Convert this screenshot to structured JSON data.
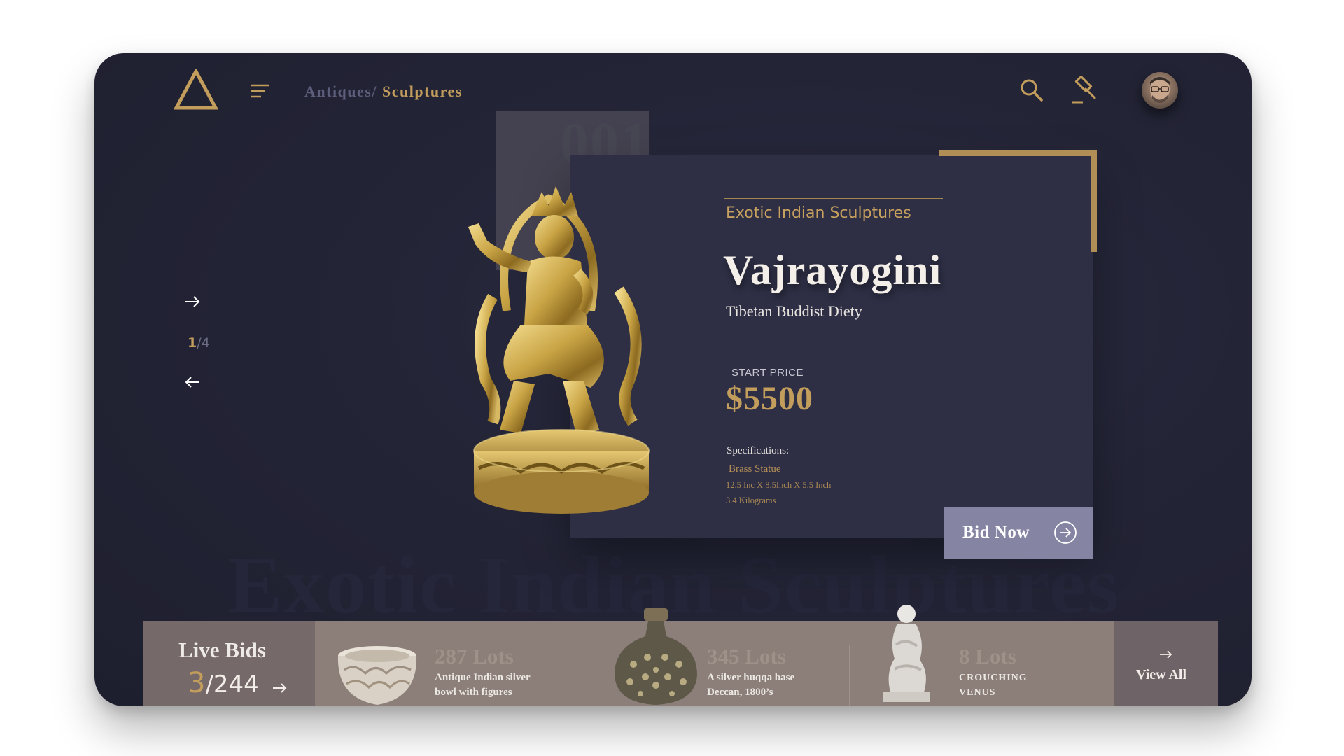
{
  "header": {
    "logo": "triangle-logo",
    "breadcrumb": {
      "parent": "Antiques/",
      "current": "Sculptures"
    },
    "icons": [
      "menu-icon",
      "search-icon",
      "gavel-icon",
      "user-avatar"
    ]
  },
  "slider": {
    "current": "1",
    "separator_total": "/4"
  },
  "product": {
    "index": "001",
    "category": "Exotic Indian Sculptures",
    "title": "Vajrayogini",
    "subtitle": "Tibetan Buddist Diety",
    "price_label": "START PRICE",
    "price": "$5500",
    "specs_label": "Specifications:",
    "specs": [
      "Brass Statue",
      "12.5 Inc X 8.5Inch X 5.5 Inch",
      "3.4 Kilograms"
    ],
    "bid_button": "Bid Now",
    "background_title": "Exotic Indian Sculptures"
  },
  "live_bids": {
    "title": "Live Bids",
    "current": "3",
    "total": "/244",
    "lots": [
      {
        "count": "287 Lots",
        "line1": "Antique Indian silver",
        "line2": "bowl with figures"
      },
      {
        "count": "345 Lots",
        "line1": "A silver huqqa base",
        "line2": "Deccan, 1800’s"
      },
      {
        "count": "8 Lots",
        "line1": "CROUCHING",
        "line2": "VENUS"
      }
    ],
    "view_all": "View All"
  },
  "colors": {
    "background": "#232436",
    "card": "#2e2f45",
    "gold": "#c29d5c",
    "bid_button": "#8584a3",
    "bids_bar": "#8c7f79"
  }
}
